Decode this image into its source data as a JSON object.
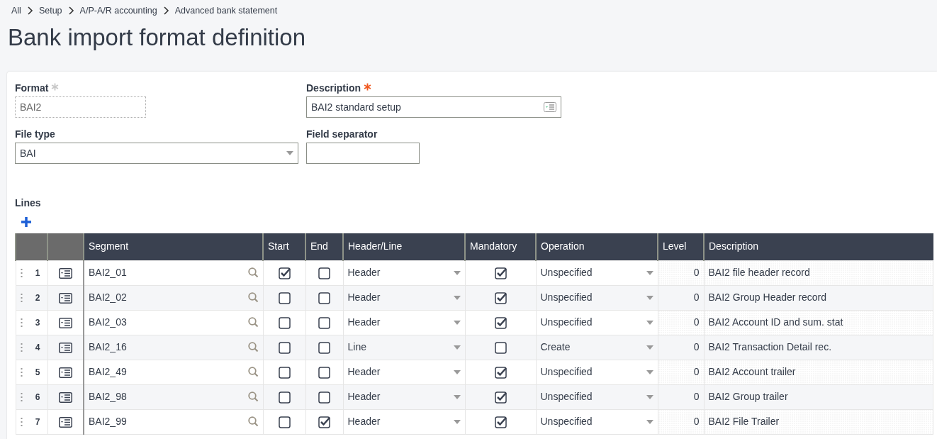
{
  "breadcrumb": [
    "All",
    "Setup",
    "A/P-A/R accounting",
    "Advanced bank statement"
  ],
  "title": "Bank import format definition",
  "fields": [
    {
      "label": "Format",
      "key_field": true,
      "required": false,
      "value": "BAI2",
      "kind": "readonly"
    },
    {
      "label": "Description",
      "key_field": false,
      "required": true,
      "value": "BAI2 standard setup",
      "kind": "text-lookup"
    },
    {
      "label": "File type",
      "key_field": false,
      "required": false,
      "value": "BAI",
      "kind": "select"
    },
    {
      "label": "Field separator",
      "key_field": false,
      "required": false,
      "kind": "text"
    }
  ],
  "lines": {
    "title": "Lines",
    "columns": [
      "Segment",
      "Start",
      "End",
      "Header/Line",
      "Mandatory",
      "Operation",
      "Level",
      "Description"
    ],
    "rows": [
      {
        "number": "1",
        "segment": "BAI2_01",
        "start": true,
        "end": false,
        "header_line": "Header",
        "mandatory": true,
        "operation": "Unspecified",
        "level_value": "0",
        "description": "BAI2 file header record"
      },
      {
        "number": "2",
        "segment": "BAI2_02",
        "start": false,
        "end": false,
        "header_line": "Header",
        "mandatory": true,
        "operation": "Unspecified",
        "level_value": "0",
        "description": "BAI2 Group Header record"
      },
      {
        "number": "3",
        "segment": "BAI2_03",
        "start": false,
        "end": false,
        "header_line": "Header",
        "mandatory": true,
        "operation": "Unspecified",
        "level_value": "0",
        "description": "BAI2 Account ID and sum. stat"
      },
      {
        "number": "4",
        "segment": "BAI2_16",
        "start": false,
        "end": false,
        "header_line": "Line",
        "mandatory": false,
        "operation": "Create",
        "level_value": "0",
        "description": "BAI2 Transaction Detail rec."
      },
      {
        "number": "5",
        "segment": "BAI2_49",
        "start": false,
        "end": false,
        "header_line": "Header",
        "mandatory": true,
        "operation": "Unspecified",
        "level_value": "0",
        "description": "BAI2 Account trailer"
      },
      {
        "number": "6",
        "segment": "BAI2_98",
        "start": false,
        "end": false,
        "header_line": "Header",
        "mandatory": true,
        "operation": "Unspecified",
        "level_value": "0",
        "description": "BAI2 Group trailer"
      },
      {
        "number": "7",
        "segment": "BAI2_99",
        "start": false,
        "end": true,
        "header_line": "Header",
        "mandatory": true,
        "operation": "Unspecified",
        "level_value": "0",
        "description": "BAI2 File Trailer"
      }
    ]
  }
}
